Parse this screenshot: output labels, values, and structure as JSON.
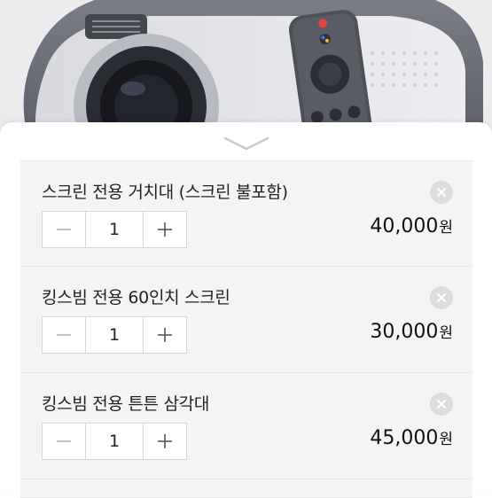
{
  "currency_unit": "원",
  "items": [
    {
      "name": "스크린 전용 거치대 (스크린 불포함)",
      "quantity": "1",
      "price": "40,000"
    },
    {
      "name": "킹스빔 전용 60인치 스크린",
      "quantity": "1",
      "price": "30,000"
    },
    {
      "name": "킹스빔 전용 튼튼 삼각대",
      "quantity": "1",
      "price": "45,000"
    }
  ],
  "icons": {
    "collapse": "chevron-down-icon",
    "remove": "close-icon",
    "decrease": "minus-icon",
    "increase": "plus-icon"
  },
  "colors": {
    "sheet_background": "#ffffff",
    "item_background": "#f4f4f4",
    "remove_button": "#dcdcdc",
    "text": "#222222"
  }
}
